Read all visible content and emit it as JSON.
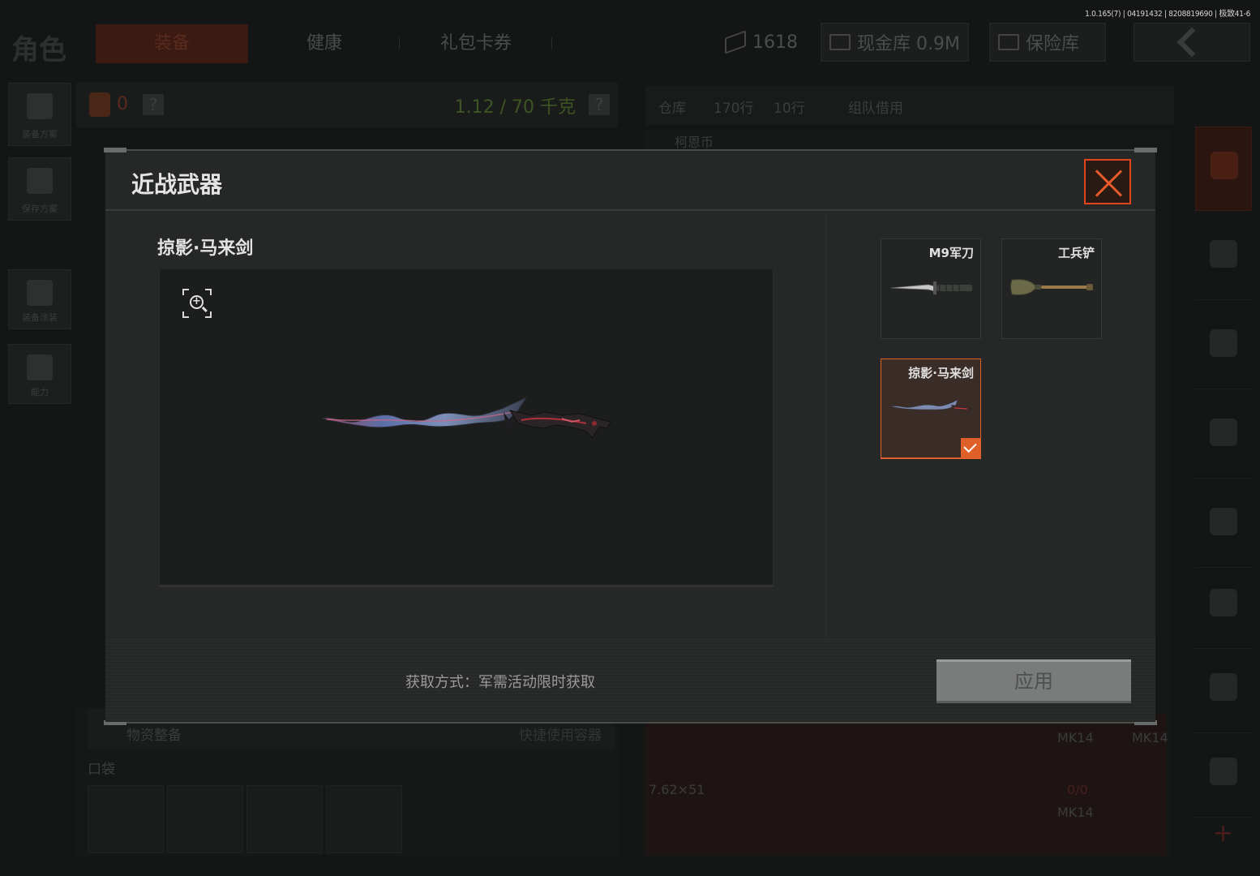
{
  "version_info": "1.0.165(7) | 04191432 | 8208819690 | 极致41-6",
  "header": {
    "title": "角色",
    "tabs": [
      {
        "label": "装备",
        "active": true
      },
      {
        "label": "健康",
        "active": false
      },
      {
        "label": "礼包卡券",
        "active": false
      }
    ],
    "resources": {
      "coins": "1618",
      "cash_vault": "现金库 0.9M",
      "safe_vault": "保险库"
    }
  },
  "left_rail": [
    {
      "label": "装备方案",
      "icon": "armor-vest-icon"
    },
    {
      "label": "保存方案",
      "icon": "download-icon"
    },
    {
      "label": "装备涂装",
      "icon": "helmet-icon"
    },
    {
      "label": "能力",
      "icon": "lightning-hexagon-icon"
    }
  ],
  "left_panel": {
    "count": "0",
    "weight": "1.12 / 70 千克",
    "help": "?",
    "supply_label": "物资整备",
    "quick_container": "快捷使用容器",
    "pocket_label": "口袋"
  },
  "right_panel": {
    "warehouse": "仓库",
    "rows_a": "170行",
    "rows_b": "10行",
    "team_credit": "组队借用",
    "currency": "柯恩币",
    "ammo_caliber": "7.62×51",
    "weapon_tag_1": "MK14",
    "weapon_tag_2": "MK14",
    "weapon_tag_3": "MK14",
    "ammo_count": "0/0"
  },
  "modal": {
    "title": "近战武器",
    "preview_name": "掠影·马来剑",
    "items": [
      {
        "label": "M9军刀",
        "selected": false,
        "icon": "bayonet-knife-icon"
      },
      {
        "label": "工兵铲",
        "selected": false,
        "icon": "shovel-icon"
      },
      {
        "label": "掠影·马来剑",
        "selected": true,
        "icon": "kris-sword-icon"
      }
    ],
    "acquire_text": "获取方式：军需活动限时获取",
    "apply_label": "应用"
  },
  "colors": {
    "accent": "#e0602a",
    "close_border": "#e0451c",
    "modal_bg": "#262727"
  }
}
